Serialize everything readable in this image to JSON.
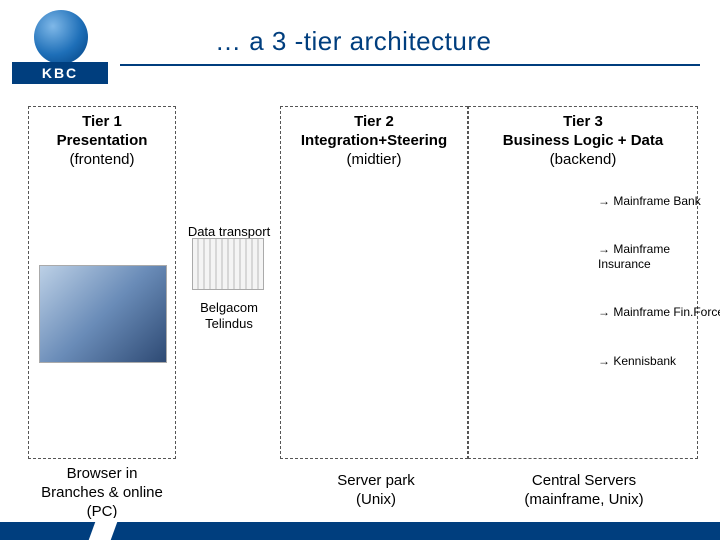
{
  "brand": {
    "name": "KBC"
  },
  "title": "… a 3 -tier architecture",
  "tiers": {
    "t1": {
      "name": "Tier 1",
      "role": "Presentation",
      "layer": "(frontend)",
      "caption": "Browser in\nBranches & online\n(PC)"
    },
    "t2": {
      "name": "Tier 2",
      "role": "Integration+Steering",
      "layer": "(midtier)",
      "caption": "Server park\n(Unix)"
    },
    "t3": {
      "name": "Tier 3",
      "role": "Business Logic + Data",
      "layer": "(backend)",
      "caption": "Central Servers\n(mainframe, Unix)"
    }
  },
  "transport": {
    "label": "Data transport",
    "carrier": "Belgacom\nTelindus"
  },
  "mainframes": [
    "→ Mainframe Bank",
    "→ Mainframe\n    Insurance",
    "→ Mainframe Fin.Force",
    "→ Kennisbank"
  ],
  "colors": {
    "brand_blue": "#003e7e"
  }
}
